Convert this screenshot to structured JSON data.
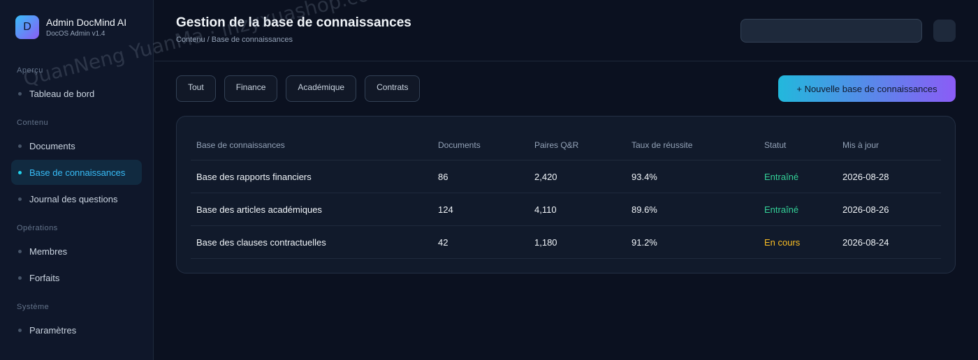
{
  "brand": {
    "logo_letter": "D",
    "name": "Admin DocMind AI",
    "version": "DocOS Admin v1.4"
  },
  "sidebar": {
    "sections": [
      {
        "title": "Aperçu",
        "items": [
          {
            "label": "Tableau de bord"
          }
        ]
      },
      {
        "title": "Contenu",
        "items": [
          {
            "label": "Documents"
          },
          {
            "label": "Base de connaissances",
            "active": true
          },
          {
            "label": "Journal des questions"
          }
        ]
      },
      {
        "title": "Opérations",
        "items": [
          {
            "label": "Membres"
          },
          {
            "label": "Forfaits"
          }
        ]
      },
      {
        "title": "Système",
        "items": [
          {
            "label": "Paramètres"
          }
        ]
      }
    ]
  },
  "header": {
    "title": "Gestion de la base de connaissances",
    "breadcrumb": "Contenu / Base de connaissances",
    "search_value": ""
  },
  "filters": [
    "Tout",
    "Finance",
    "Académique",
    "Contrats"
  ],
  "new_button_label": "+ Nouvelle base de connaissances",
  "table": {
    "columns": [
      "Base de connaissances",
      "Documents",
      "Paires Q&R",
      "Taux de réussite",
      "Statut",
      "Mis à jour"
    ],
    "rows": [
      {
        "name": "Base des rapports financiers",
        "documents": "86",
        "pairs": "2,420",
        "rate": "93.4%",
        "status": "Entraîné",
        "updated": "2026-08-28"
      },
      {
        "name": "Base des articles académiques",
        "documents": "124",
        "pairs": "4,110",
        "rate": "89.6%",
        "status": "Entraîné",
        "updated": "2026-08-26"
      },
      {
        "name": "Base des clauses contractuelles",
        "documents": "42",
        "pairs": "1,180",
        "rate": "91.2%",
        "status": "En cours",
        "updated": "2026-08-24"
      }
    ]
  },
  "watermark": "QuanNeng YuanMa · inzyxuashop.com",
  "colors": {
    "accent": "#38bdf8",
    "status_trained": "#34d399",
    "status_in_progress": "#fbbf24"
  }
}
